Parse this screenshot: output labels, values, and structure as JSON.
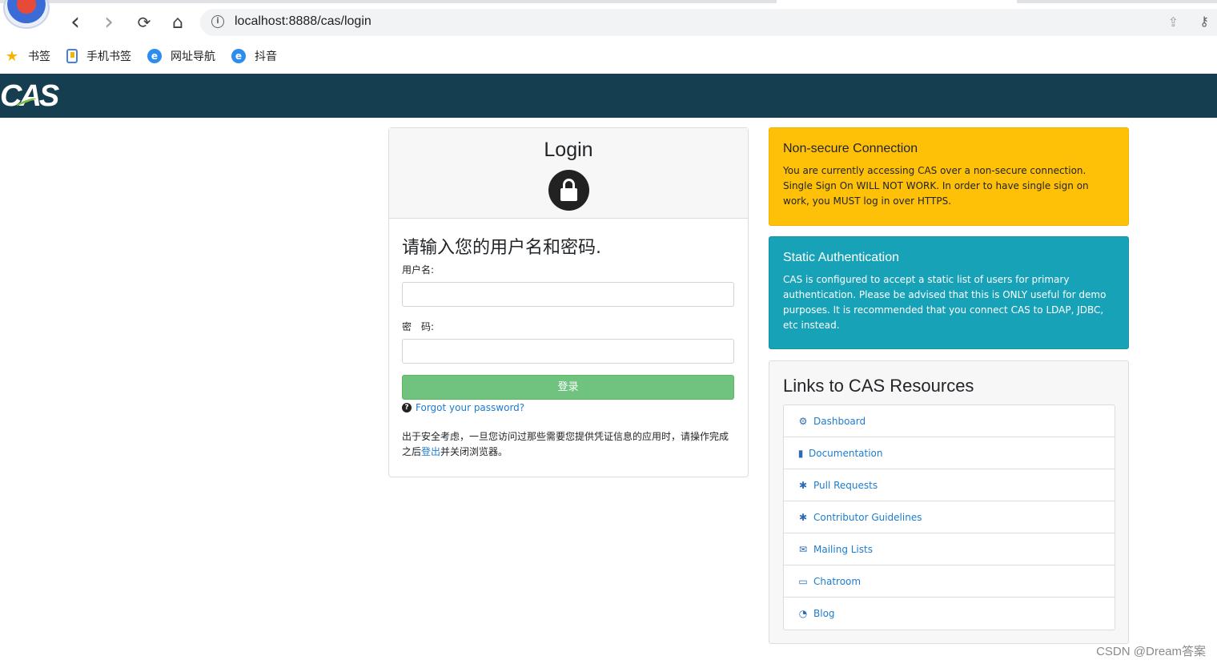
{
  "browser": {
    "url": "localhost:8888/cas/login",
    "back_icon": "‹",
    "forward_icon": "›",
    "reload_icon": "⟳",
    "home_icon": "⌂",
    "info_icon": "i",
    "share_icon": "⇪",
    "key_icon": "⚷",
    "bookmarks": [
      {
        "label": "书签",
        "icon": "star-icon"
      },
      {
        "label": "手机书签",
        "icon": "phone-bookmark-icon"
      },
      {
        "label": "网址导航",
        "icon": "browser-e-icon"
      },
      {
        "label": "抖音",
        "icon": "browser-e-icon"
      }
    ]
  },
  "header": {
    "logo_text": "CAS",
    "background": "#153e50"
  },
  "login": {
    "title": "Login",
    "prompt": "请输入您的用户名和密码.",
    "username_label": "用户名:",
    "password_label": "密　码:",
    "username_value": "",
    "password_value": "",
    "submit_label": "登录",
    "forgot_label": "Forgot your password?",
    "security_note_before": "出于安全考虑，一旦您访问过那些需要您提供凭证信息的应用时，请操作完成之后",
    "security_note_link": "登出",
    "security_note_after": "并关闭浏览器。"
  },
  "alerts": {
    "warning_title": "Non-secure Connection",
    "warning_text": "You are currently accessing CAS over a non-secure connection. Single Sign On WILL NOT WORK. In order to have single sign on work, you MUST log in over HTTPS.",
    "info_title": "Static Authentication",
    "info_text": "CAS is configured to accept a static list of users for primary authentication. Please be advised that this is ONLY useful for demo purposes. It is recommended that you connect CAS to LDAP, JDBC, etc instead.",
    "warning_color": "#ffc107",
    "info_color": "#17a2b8"
  },
  "resources": {
    "title": "Links to CAS Resources",
    "items": [
      {
        "label": "Dashboard",
        "icon": "⚙"
      },
      {
        "label": "Documentation",
        "icon": "▮"
      },
      {
        "label": "Pull Requests",
        "icon": "✱"
      },
      {
        "label": "Contributor Guidelines",
        "icon": "✱"
      },
      {
        "label": "Mailing Lists",
        "icon": "✉"
      },
      {
        "label": "Chatroom",
        "icon": "▭"
      },
      {
        "label": "Blog",
        "icon": "◔"
      }
    ]
  },
  "watermark": "CSDN @Dream答案"
}
